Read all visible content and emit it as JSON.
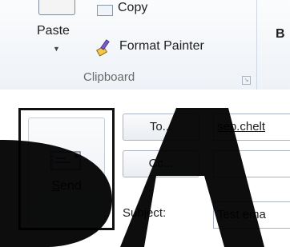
{
  "ribbon": {
    "paste_label": "Paste",
    "copy_label": "Copy",
    "format_painter_label": "Format Painter",
    "group_label": "Clipboard",
    "next_group_partial": "B"
  },
  "compose": {
    "send_label": "Send",
    "to_button": "To...",
    "cc_button": "Cc...",
    "subject_label": "Subject:",
    "to_value": "seb.chelt",
    "cc_value": "",
    "subject_value": "Test ema"
  },
  "icons": [
    "paste-icon",
    "copy-icon",
    "paintbrush-icon",
    "send-envelope-icon"
  ],
  "colors": {
    "highlight_border": "#111111",
    "ribbon_bg": "#eef2f7",
    "watermark": "#000000"
  }
}
